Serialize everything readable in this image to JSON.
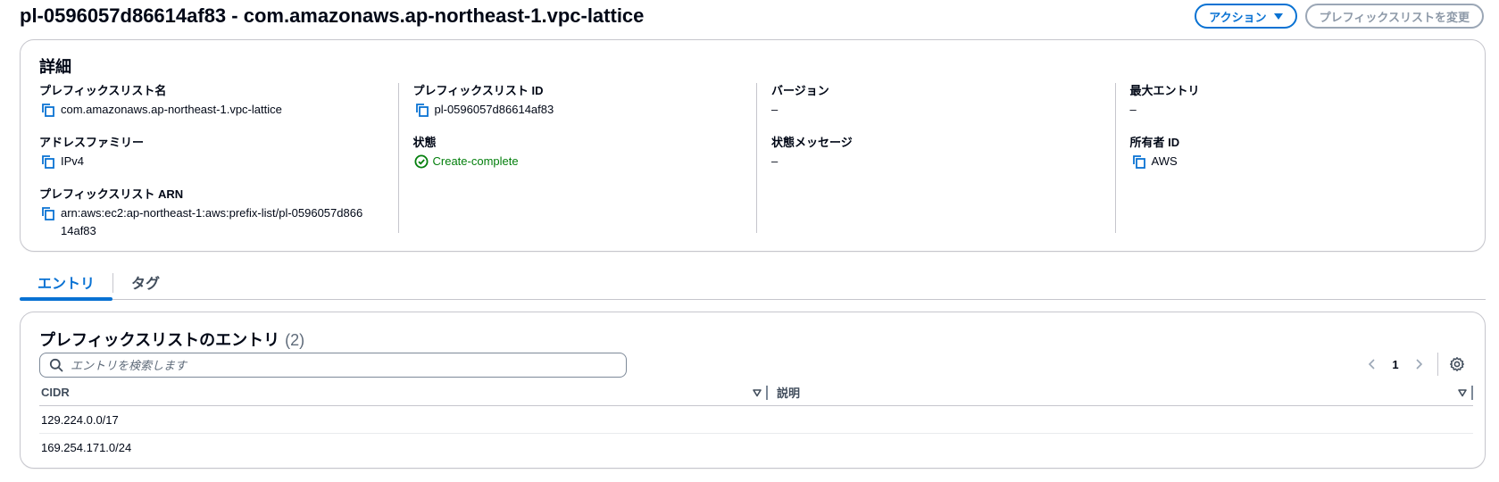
{
  "header": {
    "title": "pl-0596057d86614af83 - com.amazonaws.ap-northeast-1.vpc-lattice",
    "actions_label": "アクション",
    "modify_label": "プレフィックスリストを変更"
  },
  "details": {
    "title": "詳細",
    "prefix_list_name": {
      "key": "プレフィックスリスト名",
      "value": "com.amazonaws.ap-northeast-1.vpc-lattice"
    },
    "address_family": {
      "key": "アドレスファミリー",
      "value": "IPv4"
    },
    "prefix_list_arn": {
      "key": "プレフィックスリスト ARN",
      "value": "arn:aws:ec2:ap-northeast-1:aws:prefix-list/pl-0596057d86614af83"
    },
    "prefix_list_id": {
      "key": "プレフィックスリスト ID",
      "value": "pl-0596057d86614af83"
    },
    "state": {
      "key": "状態",
      "value": "Create-complete"
    },
    "version": {
      "key": "バージョン",
      "value": "–"
    },
    "state_message": {
      "key": "状態メッセージ",
      "value": "–"
    },
    "max_entries": {
      "key": "最大エントリ",
      "value": "–"
    },
    "owner_id": {
      "key": "所有者 ID",
      "value": "AWS"
    }
  },
  "tabs": [
    {
      "label": "エントリ",
      "active": true
    },
    {
      "label": "タグ",
      "active": false
    }
  ],
  "entries": {
    "title": "プレフィックスリストのエントリ",
    "count": "(2)",
    "search_placeholder": "エントリを検索します",
    "current_page": "1",
    "columns": {
      "cidr": "CIDR",
      "description": "説明"
    },
    "rows": [
      {
        "cidr": "129.224.0.0/17",
        "description": ""
      },
      {
        "cidr": "169.254.171.0/24",
        "description": ""
      }
    ]
  },
  "colors": {
    "accent": "#0972d3",
    "success": "#037f0c",
    "border": "#c6c6cd",
    "text": "#000716"
  },
  "icons": [
    "caret-down-icon",
    "copy-icon",
    "status-success-icon",
    "search-icon",
    "chevron-left-icon",
    "chevron-right-icon",
    "settings-icon",
    "sort-icon"
  ]
}
